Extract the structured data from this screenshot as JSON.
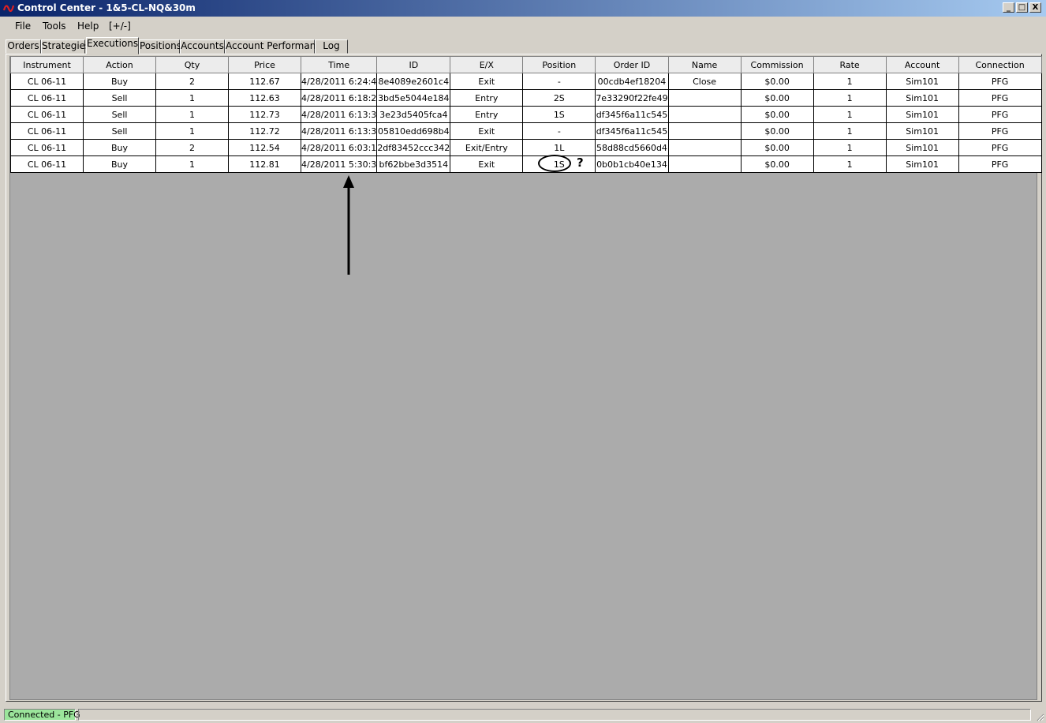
{
  "window": {
    "title": "Control Center - 1&5-CL-NQ&30m",
    "minimize_label": "_",
    "maximize_label": "□",
    "close_label": "X"
  },
  "menu": [
    "File",
    "Tools",
    "Help",
    "[+/-]"
  ],
  "tabs": [
    "Orders",
    "Strategies",
    "Executions",
    "Positions",
    "Accounts",
    "Account Performance",
    "Log"
  ],
  "active_tab": "Executions",
  "grid": {
    "columns": [
      "Instrument",
      "Action",
      "Qty",
      "Price",
      "Time",
      "ID",
      "E/X",
      "Position",
      "Order ID",
      "Name",
      "Commission",
      "Rate",
      "Account",
      "Connection"
    ],
    "rows": [
      [
        "CL 06-11",
        "Buy",
        "2",
        "112.67",
        "4/28/2011 6:24:4",
        "8e4089e2601c4",
        "Exit",
        "-",
        "00cdb4ef18204",
        "Close",
        "$0.00",
        "1",
        "Sim101",
        "PFG"
      ],
      [
        "CL 06-11",
        "Sell",
        "1",
        "112.63",
        "4/28/2011 6:18:2",
        "3bd5e5044e184",
        "Entry",
        "2S",
        "7e33290f22fe49",
        "",
        "$0.00",
        "1",
        "Sim101",
        "PFG"
      ],
      [
        "CL 06-11",
        "Sell",
        "1",
        "112.73",
        "4/28/2011 6:13:3",
        "3e23d5405fca4",
        "Entry",
        "1S",
        "df345f6a11c545",
        "",
        "$0.00",
        "1",
        "Sim101",
        "PFG"
      ],
      [
        "CL 06-11",
        "Sell",
        "1",
        "112.72",
        "4/28/2011 6:13:3",
        "05810edd698b4",
        "Exit",
        "-",
        "df345f6a11c545",
        "",
        "$0.00",
        "1",
        "Sim101",
        "PFG"
      ],
      [
        "CL 06-11",
        "Buy",
        "2",
        "112.54",
        "4/28/2011 6:03:1",
        "2df83452ccc342",
        "Exit/Entry",
        "1L",
        "58d88cd5660d4",
        "",
        "$0.00",
        "1",
        "Sim101",
        "PFG"
      ],
      [
        "CL 06-11",
        "Buy",
        "1",
        "112.81",
        "4/28/2011 5:30:3",
        "bf62bbe3d3514",
        "Exit",
        "1S",
        "0b0b1cb40e134",
        "",
        "$0.00",
        "1",
        "Sim101",
        "PFG"
      ]
    ]
  },
  "annotation": {
    "question_mark": "?"
  },
  "status": {
    "connection": "Connected - PFG",
    "connection_color": "#9be59b"
  }
}
